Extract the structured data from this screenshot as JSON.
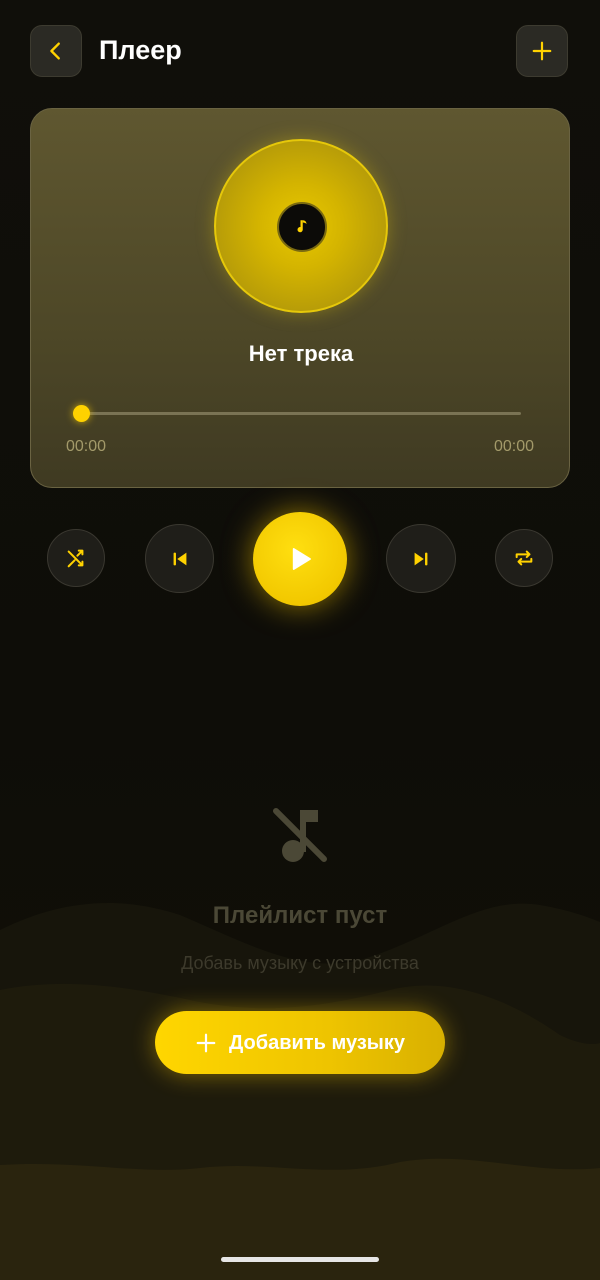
{
  "header": {
    "title": "Плеер",
    "back_icon": "chevron-left-icon",
    "add_icon": "plus-icon"
  },
  "player": {
    "cover_icon": "music-note-icon",
    "track_title": "Нет трека",
    "progress": 0,
    "time_current": "00:00",
    "time_total": "00:00"
  },
  "controls": {
    "shuffle_icon": "shuffle-icon",
    "prev_icon": "skip-previous-icon",
    "play_icon": "play-icon",
    "next_icon": "skip-next-icon",
    "repeat_icon": "repeat-icon"
  },
  "playlist": {
    "empty_icon": "music-off-icon",
    "empty_title": "Плейлист пуст",
    "empty_subtitle": "Добавь музыку с устройства",
    "add_button_label": "Добавить музыку",
    "add_button_icon": "plus-icon"
  },
  "colors": {
    "accent": "#FFD200",
    "background": "#0E0D08",
    "card": "#55502B"
  }
}
